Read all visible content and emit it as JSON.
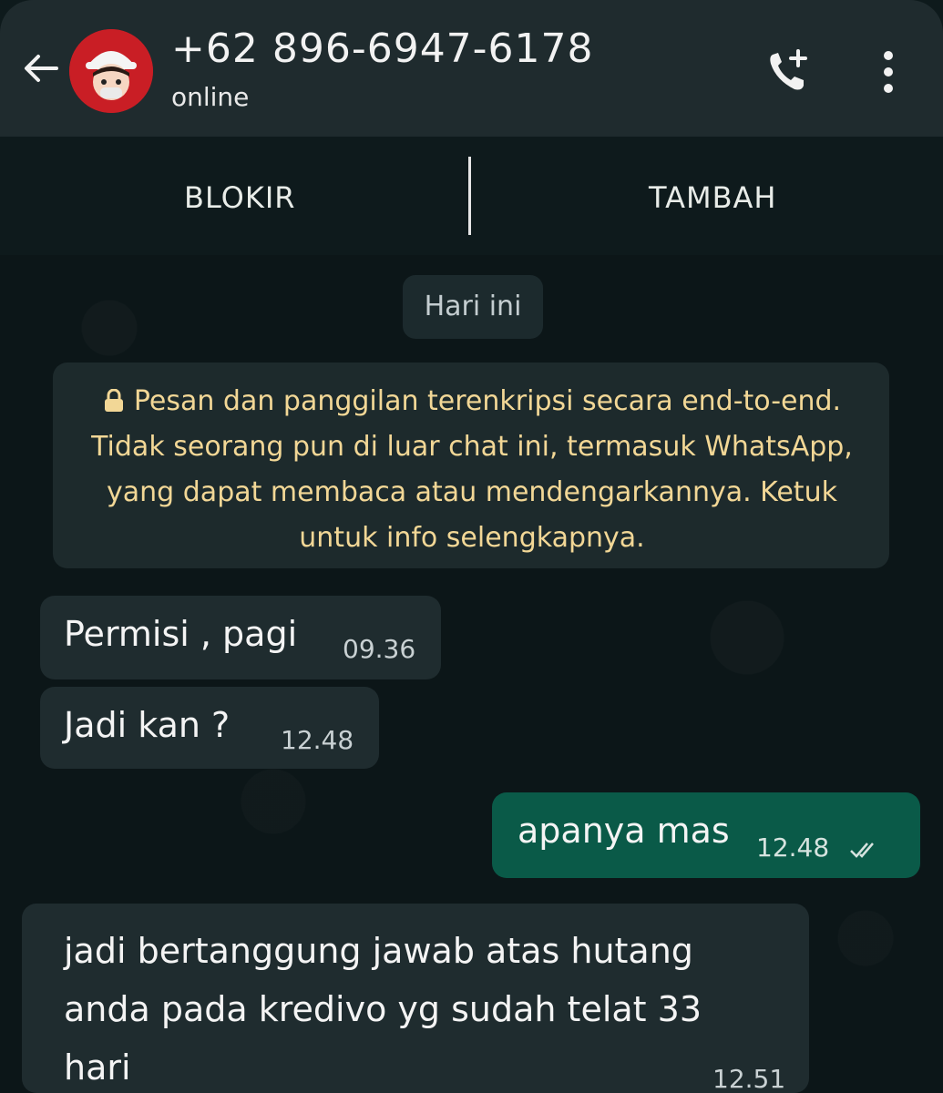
{
  "header": {
    "contact_name": "+62 896-6947-6178",
    "status": "online",
    "icons": [
      "back-arrow-icon",
      "avatar",
      "add-call-icon",
      "more-vert-icon"
    ]
  },
  "actions": {
    "block_label": "BLOKIR",
    "add_label": "TAMBAH"
  },
  "chat": {
    "date_label": "Hari ini",
    "encryption_notice": "Pesan dan panggilan terenkripsi secara end-to-end. Tidak seorang pun di luar chat ini, termasuk WhatsApp, yang dapat membaca atau mendengarkannya. Ketuk untuk info selengkapnya.",
    "messages": [
      {
        "direction": "incoming",
        "text": "Permisi , pagi",
        "time": "09.36"
      },
      {
        "direction": "incoming",
        "text": "Jadi kan ?",
        "time": "12.48"
      },
      {
        "direction": "outgoing",
        "text": "apanya mas",
        "time": "12.48",
        "status": "read"
      },
      {
        "direction": "incoming",
        "text": "jadi bertanggung jawab atas hutang anda pada kredivo yg sudah telat 33 hari",
        "time": "12.51"
      }
    ]
  },
  "colors": {
    "header_bg": "#1f2b2e",
    "chat_bg": "#0c1618",
    "incoming_bubble": "#1f2c2f",
    "outgoing_bubble": "#0a5a48",
    "notice_text": "#f2d796",
    "avatar_bg": "#c91e25"
  }
}
